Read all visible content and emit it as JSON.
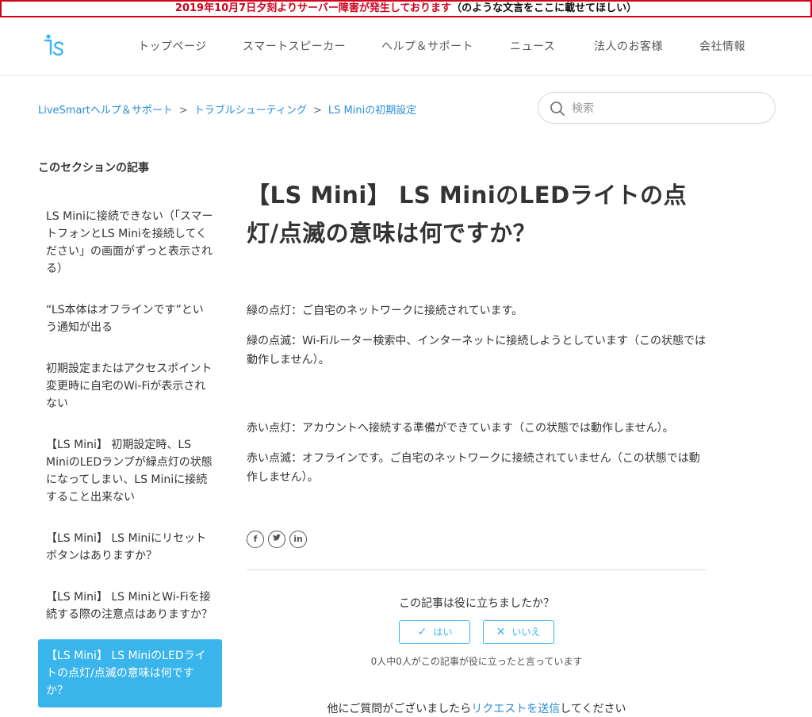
{
  "alert": {
    "red_text": "2019年10月7日夕刻よりサーバー障害が発生しております",
    "note_text": "（のような文言をここに載せてほしい）",
    "colors": {
      "red": "#d0021b"
    }
  },
  "header": {
    "logo_icon": "ls-logo-icon",
    "nav": [
      "トップページ",
      "スマートスピーカー",
      "ヘルプ＆サポート",
      "ニュース",
      "法人のお客様",
      "会社情報"
    ]
  },
  "breadcrumb": [
    "LiveSmartヘルプ＆サポート",
    "トラブルシューティング",
    "LS Miniの初期設定"
  ],
  "search": {
    "placeholder": "検索",
    "icon": "search-icon"
  },
  "sidebar": {
    "title": "このセクションの記事",
    "items": [
      "LS Miniに接続できない（「スマートフォンとLS Miniを接続してください」の画面がずっと表示される）",
      "“LS本体はオフラインです”という通知が出る",
      "初期設定またはアクセスポイント変更時に自宅のWi-Fiが表示されない",
      "【LS Mini】 初期設定時、LS MiniのLEDランプが緑点灯の状態になってしまい、LS Miniに接続すること出来ない",
      "【LS Mini】 LS Miniにリセットボタンはありますか？",
      "【LS Mini】 LS MiniとWi-Fiを接続する際の注意点はありますか？",
      "【LS Mini】 LS MiniのLEDライトの点灯/点滅の意味は何ですか？"
    ],
    "active_color": "#3ab5ec"
  },
  "article": {
    "title": "【LS Mini】 LS MiniのLEDライトの点灯/点滅の意味は何ですか？",
    "paragraphs": [
      "緑の点灯：ご自宅のネットワークに接続されています。",
      "緑の点滅：Wi-Fiルーター検索中、インターネットに接続しようとしています（この状態では動作しません）。",
      "赤い点灯：アカウントへ接続する準備ができています（この状態では動作しません）。",
      "赤い点滅：オフラインです。ご自宅のネットワークに接続されていません（この状態では動作しません）。"
    ]
  },
  "share": {
    "icons": [
      "facebook-icon",
      "twitter-icon",
      "linkedin-icon"
    ]
  },
  "vote": {
    "question": "この記事は役に立ちましたか？",
    "yes_label": "はい",
    "no_label": "いいえ",
    "count_text": "0人中0人がこの記事が役に立ったと言っています"
  },
  "request": {
    "prefix": "他にご質問がございましたら",
    "link": "リクエストを送信",
    "suffix": "してください"
  }
}
